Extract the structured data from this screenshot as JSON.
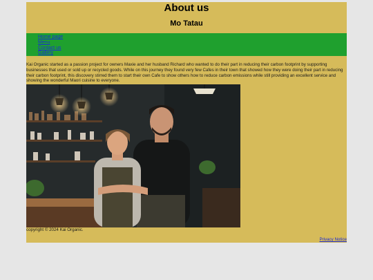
{
  "header": {
    "title": "About us",
    "subtitle": "Mo Tatau"
  },
  "nav": {
    "items": [
      {
        "label": "Home page"
      },
      {
        "label": "Menu"
      },
      {
        "label": "Contact us"
      },
      {
        "label": "Gallery"
      }
    ]
  },
  "main": {
    "intro": "Kai Organic started as a passion project for owners Maxie and her husband Richard who wanted to do their part in reducing their carbon footprint by supporting businesses that used or sold up or recycled goods. While on this journey they found very few Cafes in their town that showed how they were doing their part in reducing their carbon footprint, this discovery stirred them to start their own Cafe to show others how to reduce carbon emissions while still providing an excellent service and showing the wonderful Maori cuisine to everyone."
  },
  "footer": {
    "copyright": "copyright © 2024 Kai Organic.",
    "privacy_label": "Privacy Notice"
  },
  "colors": {
    "page_background": "#d6bb5a",
    "nav_background": "#1fa02e",
    "link": "#1a2ad8"
  }
}
